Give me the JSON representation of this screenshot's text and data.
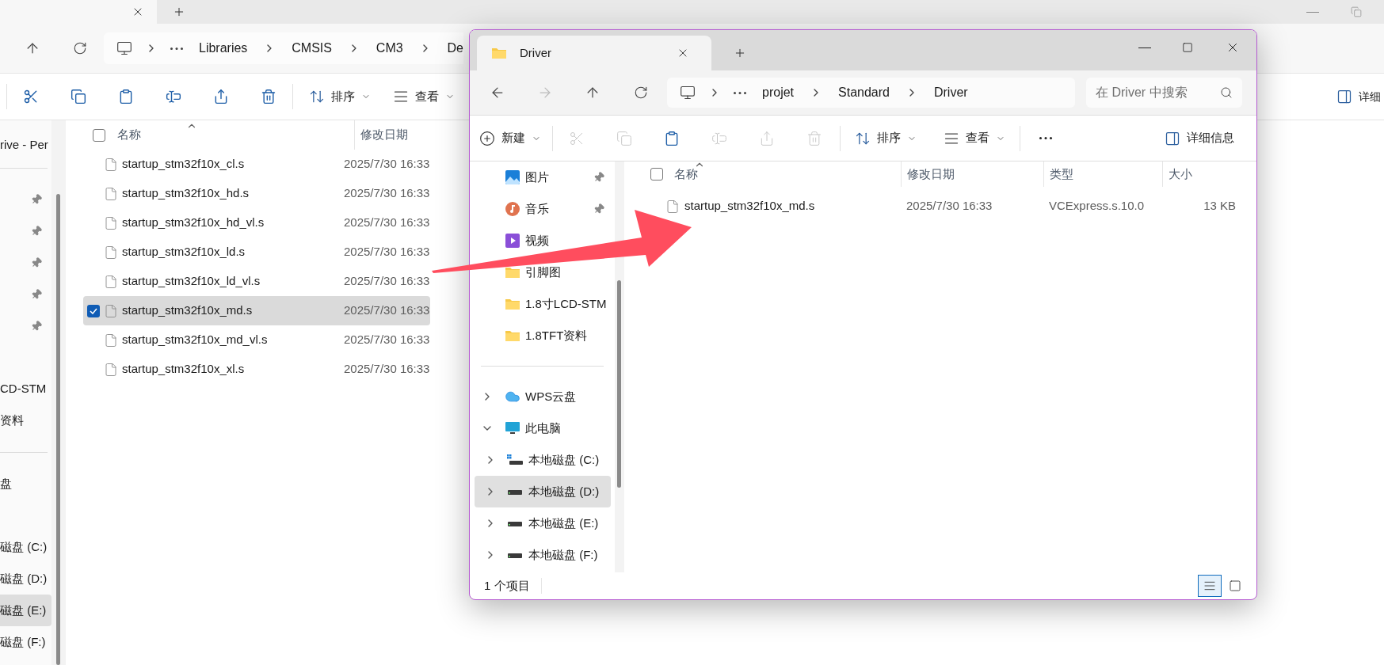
{
  "background_window": {
    "breadcrumb": [
      "Libraries",
      "CMSIS",
      "CM3",
      "De"
    ],
    "toolbar": {
      "actions": [
        {
          "kind": "cut",
          "disabled": false
        },
        {
          "kind": "copy",
          "disabled": false
        },
        {
          "kind": "paste",
          "disabled": false
        },
        {
          "kind": "rename",
          "disabled": false
        },
        {
          "kind": "share",
          "disabled": false
        },
        {
          "kind": "delete",
          "disabled": false
        }
      ],
      "sort": "排序",
      "view": "查看",
      "details": "详细"
    },
    "sidebar_groups": [
      [
        {
          "kind": "text",
          "label": "rive - Per",
          "selected": false
        }
      ],
      [
        {
          "kind": "pin",
          "selected": false
        },
        {
          "kind": "pin",
          "selected": false
        },
        {
          "kind": "pin",
          "selected": false
        },
        {
          "kind": "pin",
          "selected": false
        },
        {
          "kind": "pin",
          "selected": false
        }
      ],
      [
        {
          "kind": "text",
          "label": "CD-STM",
          "selected": false
        },
        {
          "kind": "text",
          "label": "资料",
          "selected": false
        }
      ],
      [
        {
          "kind": "text",
          "label": "盘",
          "selected": false
        }
      ],
      [
        {
          "kind": "text",
          "label": "磁盘 (C:)",
          "selected": false
        },
        {
          "kind": "text",
          "label": "磁盘 (D:)",
          "selected": false
        },
        {
          "kind": "text",
          "label": "磁盘 (E:)",
          "selected": true
        },
        {
          "kind": "text",
          "label": "磁盘 (F:)",
          "selected": false
        }
      ]
    ],
    "columns": [
      "名称",
      "修改日期"
    ],
    "select_all": {
      "checked": false
    },
    "files": [
      {
        "name": "startup_stm32f10x_cl.s",
        "modified": "2025/7/30 16:33",
        "selected": false
      },
      {
        "name": "startup_stm32f10x_hd.s",
        "modified": "2025/7/30 16:33",
        "selected": false
      },
      {
        "name": "startup_stm32f10x_hd_vl.s",
        "modified": "2025/7/30 16:33",
        "selected": false
      },
      {
        "name": "startup_stm32f10x_ld.s",
        "modified": "2025/7/30 16:33",
        "selected": false
      },
      {
        "name": "startup_stm32f10x_ld_vl.s",
        "modified": "2025/7/30 16:33",
        "selected": false
      },
      {
        "name": "startup_stm32f10x_md.s",
        "modified": "2025/7/30 16:33",
        "selected": true
      },
      {
        "name": "startup_stm32f10x_md_vl.s",
        "modified": "2025/7/30 16:33",
        "selected": false
      },
      {
        "name": "startup_stm32f10x_xl.s",
        "modified": "2025/7/30 16:33",
        "selected": false
      }
    ]
  },
  "driver_window": {
    "tab": {
      "title": "Driver"
    },
    "breadcrumb": [
      "projet",
      "Standard",
      "Driver"
    ],
    "search": {
      "placeholder": "在 Driver 中搜索"
    },
    "toolbar": {
      "new": "新建",
      "actions": [
        {
          "kind": "cut",
          "disabled": true
        },
        {
          "kind": "copy",
          "disabled": true
        },
        {
          "kind": "paste",
          "disabled": false
        },
        {
          "kind": "rename",
          "disabled": true
        },
        {
          "kind": "share",
          "disabled": true
        },
        {
          "kind": "delete",
          "disabled": true
        }
      ],
      "sort": "排序",
      "view": "查看",
      "details": "详细信息"
    },
    "quick_access": [
      {
        "kind": "pictures",
        "label": "图片",
        "pinned": true,
        "selected": false
      },
      {
        "kind": "music",
        "label": "音乐",
        "pinned": true,
        "selected": false
      },
      {
        "kind": "videos",
        "label": "视频",
        "pinned": false,
        "selected": false
      },
      {
        "kind": "folder",
        "label": "引脚图",
        "pinned": false,
        "selected": false
      },
      {
        "kind": "folder",
        "label": "1.8寸LCD-STM",
        "pinned": false,
        "selected": false
      },
      {
        "kind": "folder",
        "label": "1.8TFT资料",
        "pinned": false,
        "selected": false
      }
    ],
    "tree": [
      {
        "kind": "cloud",
        "label": "WPS云盘",
        "expanded": false,
        "selected": false
      },
      {
        "kind": "pc",
        "label": "此电脑",
        "expanded": true,
        "selected": false,
        "children": [
          {
            "kind": "system-drive",
            "label": "本地磁盘 (C:)",
            "expanded": false,
            "selected": false
          },
          {
            "kind": "drive",
            "label": "本地磁盘 (D:)",
            "expanded": false,
            "selected": true
          },
          {
            "kind": "drive",
            "label": "本地磁盘 (E:)",
            "expanded": false,
            "selected": false
          },
          {
            "kind": "drive",
            "label": "本地磁盘 (F:)",
            "expanded": false,
            "selected": false
          }
        ]
      }
    ],
    "columns": [
      "名称",
      "修改日期",
      "类型",
      "大小"
    ],
    "select_all": {
      "checked": false
    },
    "files": [
      {
        "name": "startup_stm32f10x_md.s",
        "modified": "2025/7/30 16:33",
        "type": "VCExpress.s.10.0",
        "size": "13 KB",
        "selected": false
      }
    ],
    "status": "1 个项目",
    "view_modes": [
      {
        "kind": "details",
        "selected": true
      },
      {
        "kind": "tiles",
        "selected": false
      }
    ]
  }
}
